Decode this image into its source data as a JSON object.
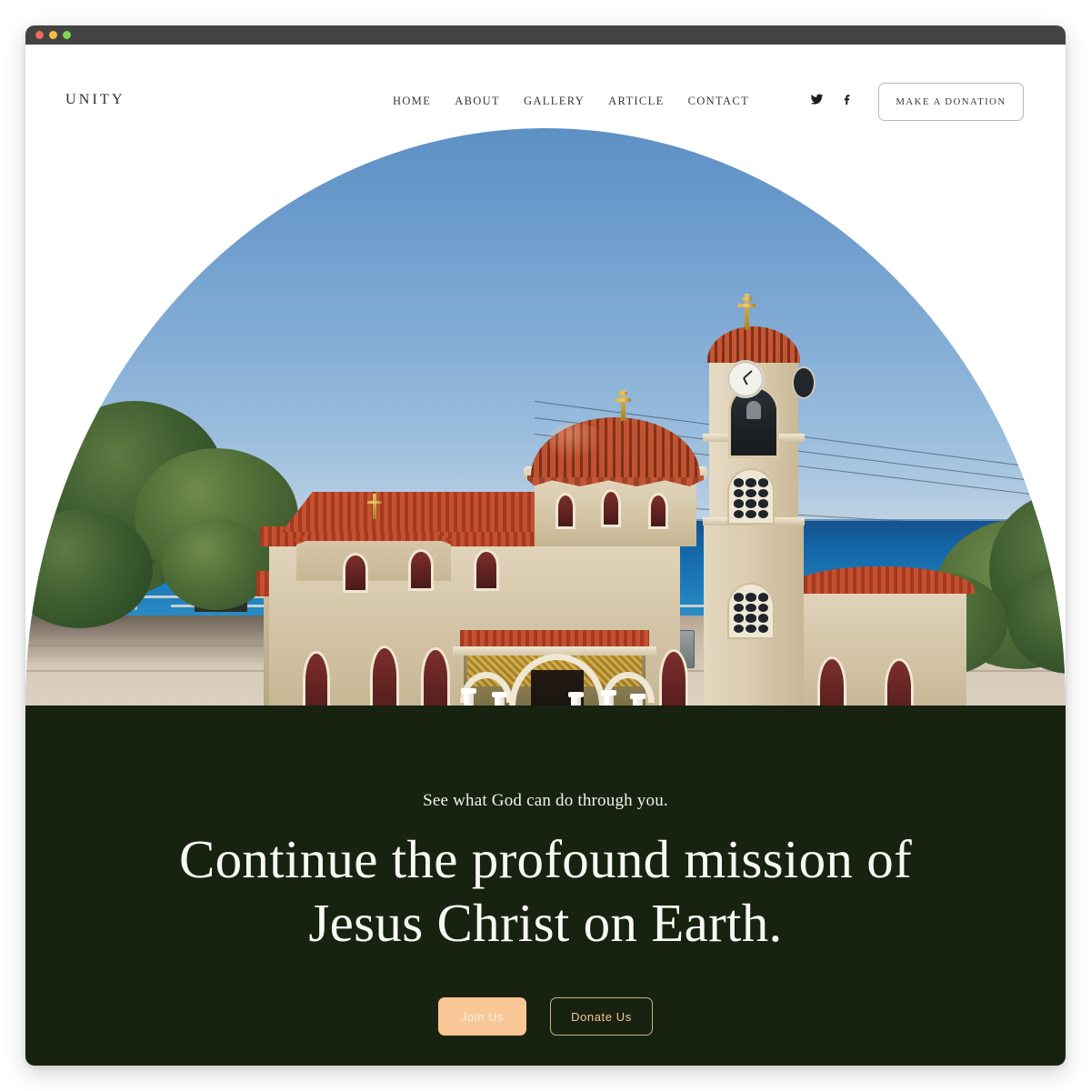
{
  "window": {
    "traffic_lights": [
      "close",
      "minimize",
      "maximize"
    ],
    "chrome_color": "#434343"
  },
  "header": {
    "brand": "UNITY",
    "nav": [
      {
        "label": "HOME",
        "name": "nav-home"
      },
      {
        "label": "ABOUT",
        "name": "nav-about"
      },
      {
        "label": "GALLERY",
        "name": "nav-gallery"
      },
      {
        "label": "ARTICLE",
        "name": "nav-article"
      },
      {
        "label": "CONTACT",
        "name": "nav-contact"
      }
    ],
    "social": [
      {
        "icon": "twitter-icon",
        "label": "Twitter"
      },
      {
        "icon": "facebook-icon",
        "label": "Facebook"
      }
    ],
    "donation_button": "MAKE A DONATION"
  },
  "hero": {
    "shape": "arch",
    "alt": "Greek Orthodox stone church with terracotta domes, bell tower with clock and gold crosses, overlooking the blue sea",
    "sky_color": "#6e9dcd",
    "sea_color": "#1466a8",
    "stone_color": "#d5c6a9",
    "roof_color": "#c4512f"
  },
  "cta": {
    "eyebrow": "See what God can do through you.",
    "heading_line1": "Continue the profound mission of",
    "heading_line2": "Jesus Christ on Earth.",
    "background_color": "#182210",
    "accent_color": "#f9c795",
    "buttons": [
      {
        "label": "Join Us",
        "style": "filled"
      },
      {
        "label": "Donate Us",
        "style": "outline"
      }
    ]
  }
}
